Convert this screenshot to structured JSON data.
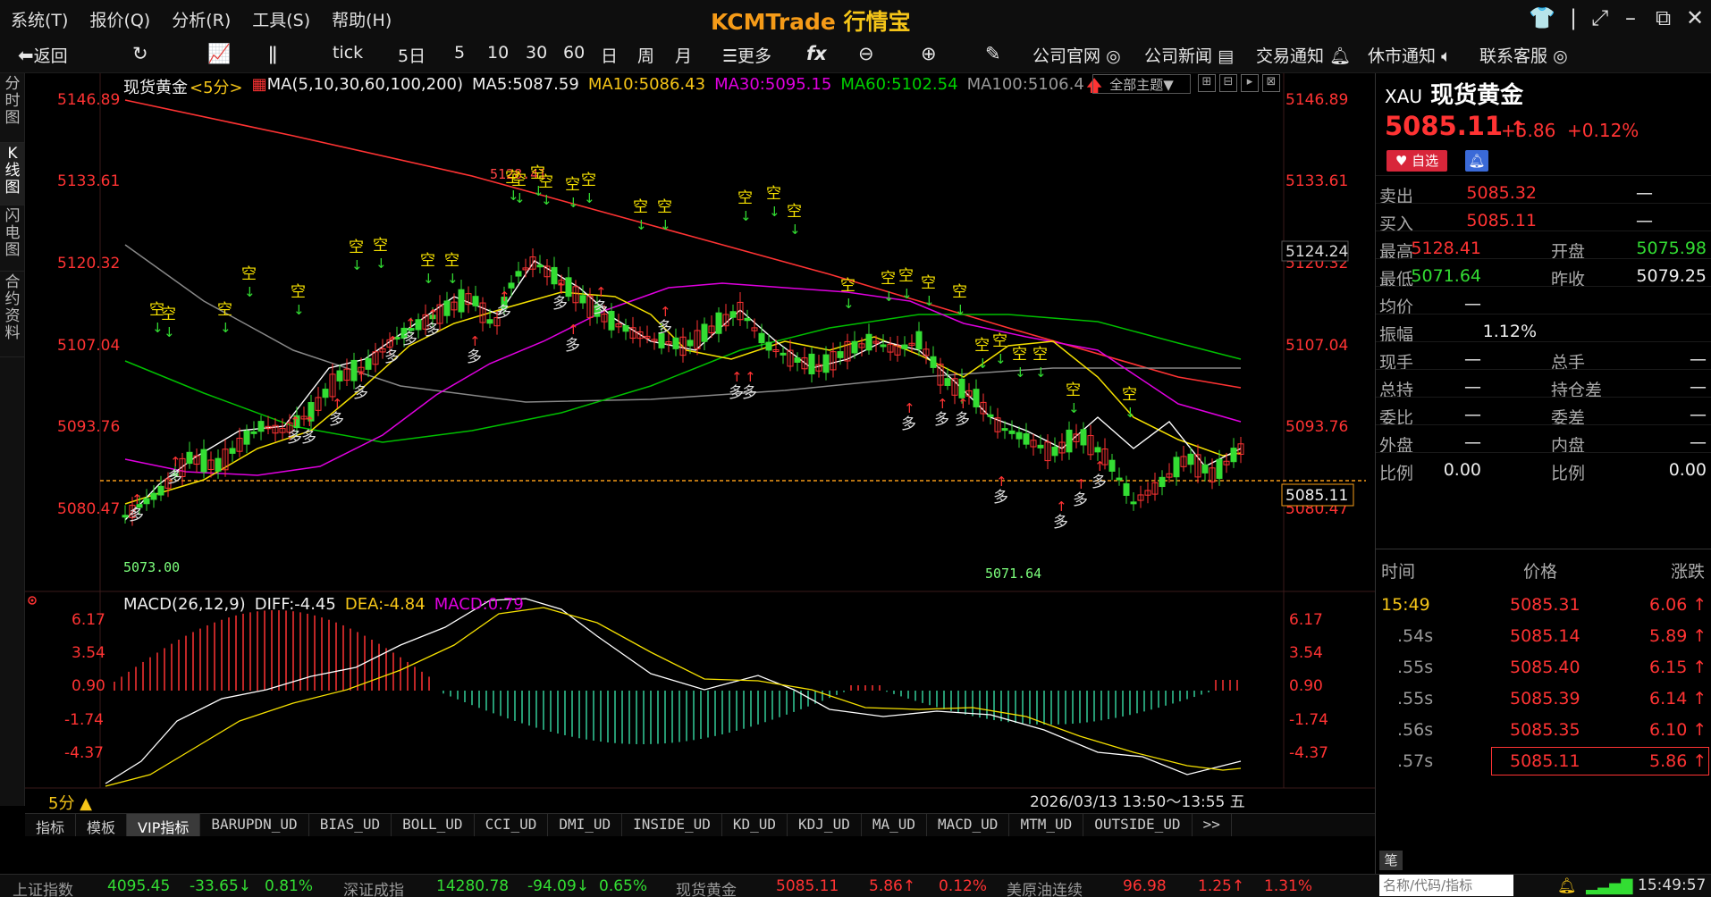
{
  "menu": [
    "系统(T)",
    "报价(Q)",
    "分析(R)",
    "工具(S)",
    "帮助(H)"
  ],
  "app_title": {
    "brand": "KCMTrade",
    "name": "行情宝"
  },
  "toolbar": {
    "back": "返回",
    "periods": [
      "tick",
      "5日",
      "5",
      "10",
      "30",
      "60",
      "日",
      "周",
      "月"
    ],
    "more": "更多",
    "links": [
      "公司官网",
      "公司新闻",
      "交易通知",
      "休市通知",
      "联系客服"
    ]
  },
  "sidebar": [
    "分时图",
    "K线图",
    "闪电图",
    "合约资料"
  ],
  "ma_header": {
    "name": "现货黄金",
    "period": "<5分>",
    "ma_def": "MA(5,10,30,60,100,200)",
    "ma5": "MA5:5087.59",
    "ma10": "MA10:5086.43",
    "ma30": "MA30:5095.15",
    "ma60": "MA60:5102.54",
    "ma100": "MA100:5106.4"
  },
  "theme_select": "全部主题▼",
  "y_axis": [
    "5146.89",
    "5133.61",
    "5120.32",
    "5107.04",
    "5093.76",
    "5080.47"
  ],
  "y_markers": {
    "high_line": "5124.24",
    "current": "5085.11"
  },
  "chart_annotations": {
    "low_left": "5073.00",
    "low_right": "5071.64",
    "high": "5128.41"
  },
  "macd_header": {
    "def": "MACD(26,12,9)",
    "diff": "DIFF:-4.45",
    "dea": "DEA:-4.84",
    "macd": "MACD:0.79"
  },
  "macd_axis": [
    "6.17",
    "3.54",
    "0.90",
    "-1.74",
    "-4.37"
  ],
  "period_label": "5分 ▲",
  "time_range": "2026/03/13 13:50～13:55 五",
  "indicator_tabs": [
    "指标",
    "模板",
    "VIP指标",
    "BARUPDN_UD",
    "BIAS_UD",
    "BOLL_UD",
    "CCI_UD",
    "DMI_UD",
    "INSIDE_UD",
    "KD_UD",
    "KDJ_UD",
    "MA_UD",
    "MACD_UD",
    "MTM_UD",
    "OUTSIDE_UD",
    ">>"
  ],
  "quote": {
    "code": "XAU",
    "name": "现货黄金",
    "price": "5085.11",
    "change": "+5.86",
    "change_pct": "+0.12%",
    "fav": "自选",
    "rows": [
      {
        "l": "卖出",
        "v": "5085.32",
        "l2": "",
        "v2": "—"
      },
      {
        "l": "买入",
        "v": "5085.11",
        "l2": "",
        "v2": "—"
      },
      {
        "l": "最高",
        "v": "5128.41",
        "l2": "开盘",
        "v2": "5075.98"
      },
      {
        "l": "最低",
        "v": "5071.64",
        "l2": "昨收",
        "v2": "5079.25"
      },
      {
        "l": "均价",
        "v": "—",
        "l2": "",
        "v2": ""
      },
      {
        "l": "振幅",
        "v": "1.12%",
        "l2": "",
        "v2": ""
      },
      {
        "l": "现手",
        "v": "—",
        "l2": "总手",
        "v2": "—"
      },
      {
        "l": "总持",
        "v": "—",
        "l2": "持仓差",
        "v2": "—"
      },
      {
        "l": "委比",
        "v": "—",
        "l2": "委差",
        "v2": "—"
      },
      {
        "l": "外盘",
        "v": "—",
        "l2": "内盘",
        "v2": "—"
      },
      {
        "l": "比例",
        "v": "0.00",
        "l2": "比例",
        "v2": "0.00"
      }
    ]
  },
  "ticks": {
    "headers": [
      "时间",
      "价格",
      "涨跌"
    ],
    "rows": [
      {
        "t": "15:49",
        "p": "5085.31",
        "c": "6.06"
      },
      {
        "t": ".54s",
        "p": "5085.14",
        "c": "5.89"
      },
      {
        "t": ".55s",
        "p": "5085.40",
        "c": "6.15"
      },
      {
        "t": ".55s",
        "p": "5085.39",
        "c": "6.14"
      },
      {
        "t": ".56s",
        "p": "5085.35",
        "c": "6.10"
      },
      {
        "t": ".57s",
        "p": "5085.11",
        "c": "5.86"
      }
    ]
  },
  "pen_label": "笔",
  "statusbar": {
    "sh_name": "上证指数",
    "sh_val": "4095.45",
    "sh_chg": "-33.65↓",
    "sh_pct": "0.81%",
    "sz_name": "深证成指",
    "sz_val": "14280.78",
    "sz_chg": "-94.09↓",
    "sz_pct": "0.65%",
    "au_name": "现货黄金",
    "au_val": "5085.11",
    "au_chg": "5.86↑",
    "au_pct": "0.12%",
    "oil_name": "美原油连续",
    "oil_val": "96.98",
    "oil_chg": "1.25↑",
    "oil_pct": "1.31%",
    "search_placeholder": "名称/代码/指标",
    "clock": "15:49:57"
  },
  "colors": {
    "up": "#ff3333",
    "down": "#33dd33",
    "ma5": "#ffffff",
    "ma10": "#f5e000",
    "ma30": "#e000e0",
    "ma60": "#00c000",
    "ma100": "#888888",
    "ma200": "#ff3333"
  }
}
